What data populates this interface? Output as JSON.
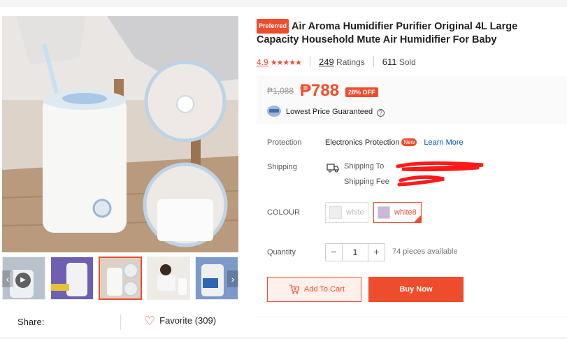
{
  "product": {
    "preferred_badge": "Preferred",
    "title": "Air Aroma Humidifier Purifier Original 4L Large Capacity Household Mute Air Humidifier For Baby"
  },
  "rating": {
    "score": "4.9",
    "stars": "★★★★★",
    "ratings_count": "249",
    "ratings_label": "Ratings",
    "sold_count": "611",
    "sold_label": "Sold"
  },
  "price": {
    "original": "₱1,088",
    "current": "₱788",
    "discount": "28% OFF",
    "guarantee": "Lowest Price Guaranteed"
  },
  "protection": {
    "label": "Protection",
    "value": "Electronics Protection",
    "new_badge": "New",
    "learn_more": "Learn More"
  },
  "shipping": {
    "label": "Shipping",
    "ship_to": "Shipping To",
    "ship_fee": "Shipping Fee"
  },
  "colour": {
    "label": "COLOUR",
    "options": [
      {
        "name": "white",
        "selected": false
      },
      {
        "name": "white8",
        "selected": true
      }
    ]
  },
  "quantity": {
    "label": "Quantity",
    "value": "1",
    "minus": "−",
    "plus": "+",
    "available": "74 pieces available"
  },
  "actions": {
    "add_to_cart": "Add To Cart",
    "buy_now": "Buy Now"
  },
  "share": {
    "label": "Share:",
    "favorite": "Favorite (309)"
  },
  "colors": {
    "accent": "#ee4d2d",
    "link": "#0055aa"
  }
}
